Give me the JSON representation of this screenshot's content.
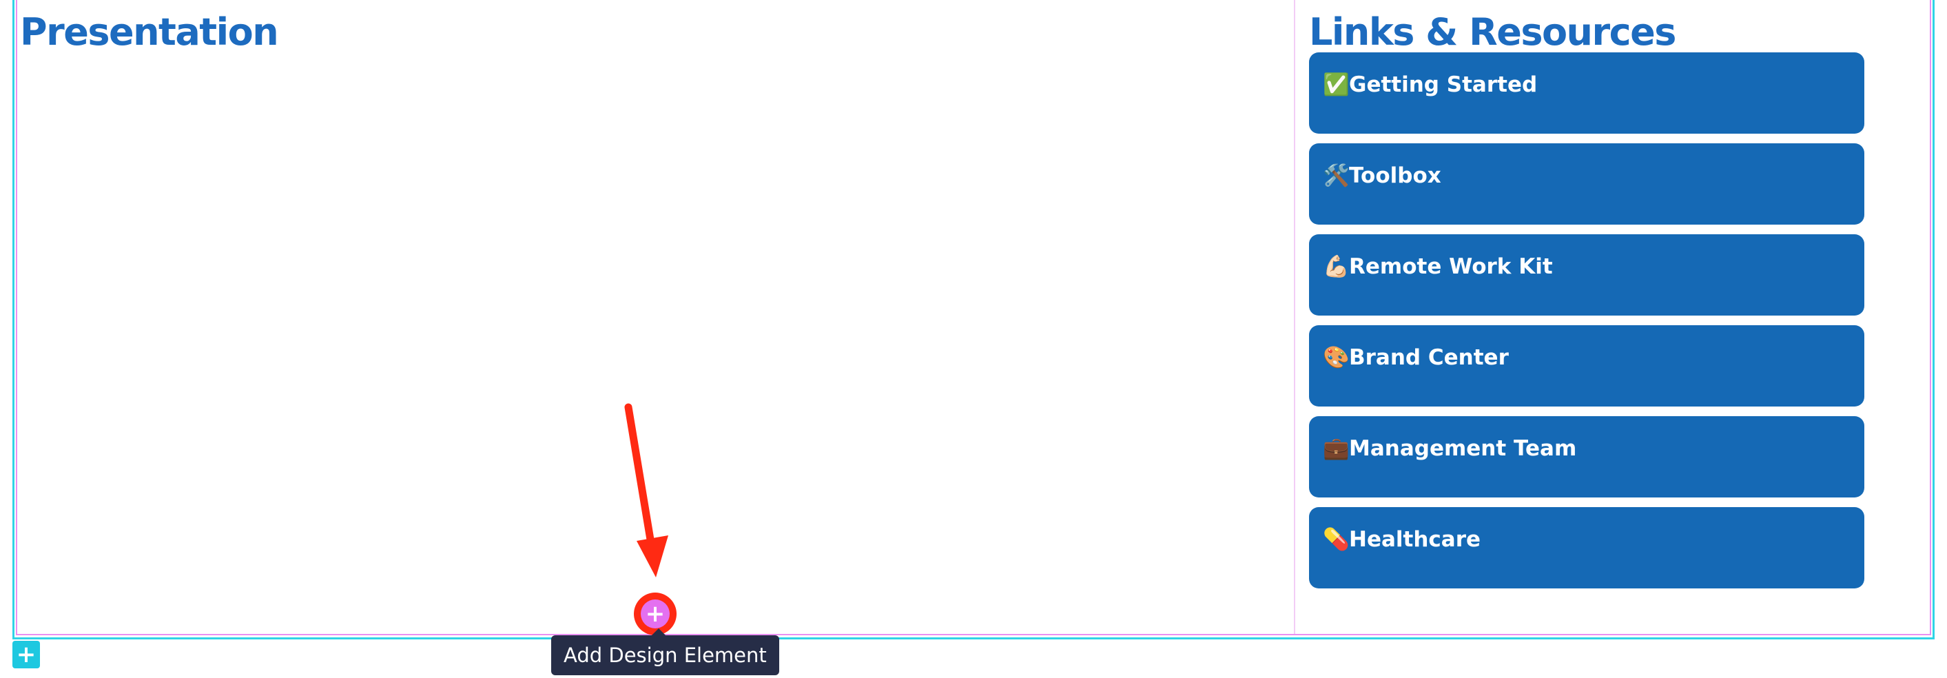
{
  "left_column": {
    "heading": "Presentation"
  },
  "right_column": {
    "heading": "Links & Resources",
    "links": [
      {
        "emoji": "✅",
        "label": "Getting Started"
      },
      {
        "emoji": "🛠️",
        "label": "Toolbox"
      },
      {
        "emoji": "💪🏻",
        "label": "Remote Work Kit"
      },
      {
        "emoji": "🎨",
        "label": "Brand Center"
      },
      {
        "emoji": "💼",
        "label": "Management Team"
      },
      {
        "emoji": "💊",
        "label": "Healthcare"
      }
    ]
  },
  "builder": {
    "add_element_symbol": "+",
    "add_element_tooltip": "Add Design Element",
    "add_row_symbol": "+"
  },
  "colors": {
    "heading": "#1d6bbf",
    "link_button_bg": "#1569b5",
    "row_frame": "#2fd3e6",
    "section_frame": "#e98ff2",
    "annotation_arrow": "#ff2a13",
    "add_element_button": "#e470f0",
    "tooltip_bg": "#262d47"
  },
  "icons": {
    "annotation": "red-arrow-down",
    "add_element": "plus-circle-icon",
    "add_row": "plus-square-icon"
  }
}
